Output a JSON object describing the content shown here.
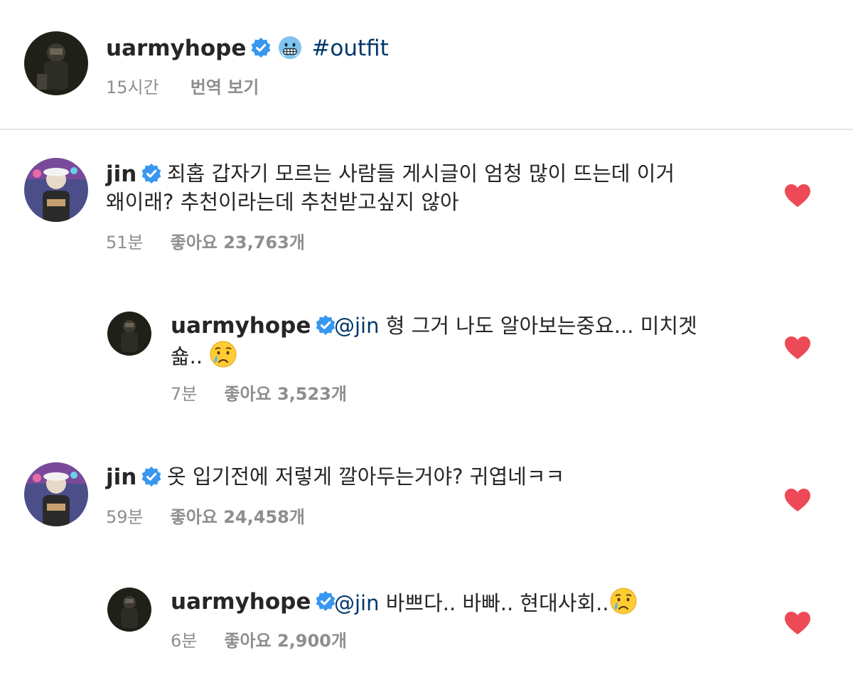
{
  "caption": {
    "username": "uarmyhope",
    "emoji_icon": "freezing-face-emoji",
    "hashtag": "#outfit",
    "time": "15시간",
    "translate": "번역 보기"
  },
  "comments": [
    {
      "username": "jin",
      "text_line1": "죄홉 갑자기 모르는 사람들 게시글이 엄청 많이 뜨는데 이거",
      "text_line2": "왜이래? 추천이라는데 추천받고싶지 않아",
      "time": "51분",
      "likes": "좋아요 23,763개"
    },
    {
      "username": "uarmyhope",
      "mention": "@jin",
      "text_line1": "형 그거 나도 알아보는중요... 미치겟",
      "text_line2": "숇..",
      "emoji_icon": "crying-face-emoji",
      "time": "7분",
      "likes": "좋아요 3,523개"
    },
    {
      "username": "jin",
      "text_line1": "옷 입기전에 저렇게 깔아두는거야? 귀엽네ㅋㅋ",
      "time": "59분",
      "likes": "좋아요 24,458개"
    },
    {
      "username": "uarmyhope",
      "mention": "@jin",
      "text_line1": "바쁘다.. 바빠.. 현대사회..",
      "emoji_icon": "crying-face-emoji",
      "time": "6분",
      "likes": "좋아요 2,900개"
    }
  ],
  "colors": {
    "verified_badge": "#3897f0",
    "link": "#00376b",
    "heart": "#ed4956",
    "meta_text": "#8e8e8e"
  }
}
